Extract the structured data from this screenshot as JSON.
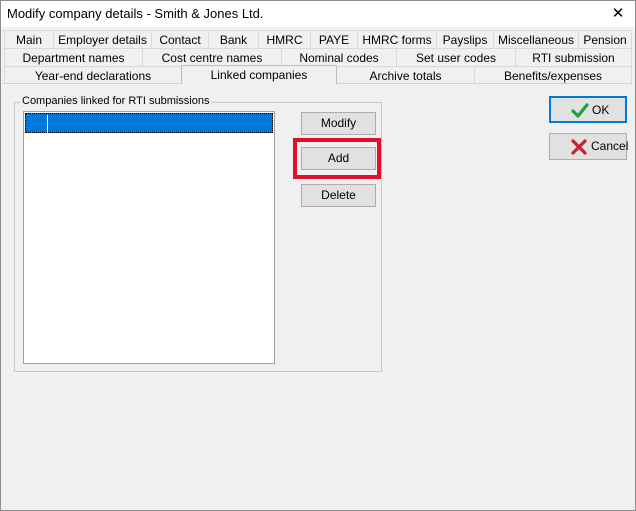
{
  "window": {
    "title": "Modify company details - Smith & Jones Ltd.",
    "close_glyph": "✕"
  },
  "tabs": {
    "row1": [
      "Main",
      "Employer details",
      "Contact",
      "Bank",
      "HMRC",
      "PAYE",
      "HMRC forms",
      "Payslips",
      "Miscellaneous",
      "Pension"
    ],
    "row2": [
      "Department names",
      "Cost centre names",
      "Nominal codes",
      "Set user codes",
      "RTI submission"
    ],
    "row3": [
      "Year-end declarations",
      "Linked companies",
      "Archive totals",
      "Benefits/expenses"
    ],
    "active": "Linked companies"
  },
  "linked": {
    "group_label": "Companies linked for RTI submissions",
    "list_rows": [
      ""
    ],
    "selected_row": 0,
    "modify_label": "Modify",
    "add_label": "Add",
    "delete_label": "Delete"
  },
  "dialog_buttons": {
    "ok_label": "OK",
    "cancel_label": "Cancel",
    "ok_icon": "checkmark-icon",
    "cancel_icon": "cross-icon"
  },
  "colors": {
    "selection": "#0078d7",
    "highlight_box": "#e00f2a",
    "ok_check": "#22a035",
    "cancel_cross": "#c8202c"
  }
}
